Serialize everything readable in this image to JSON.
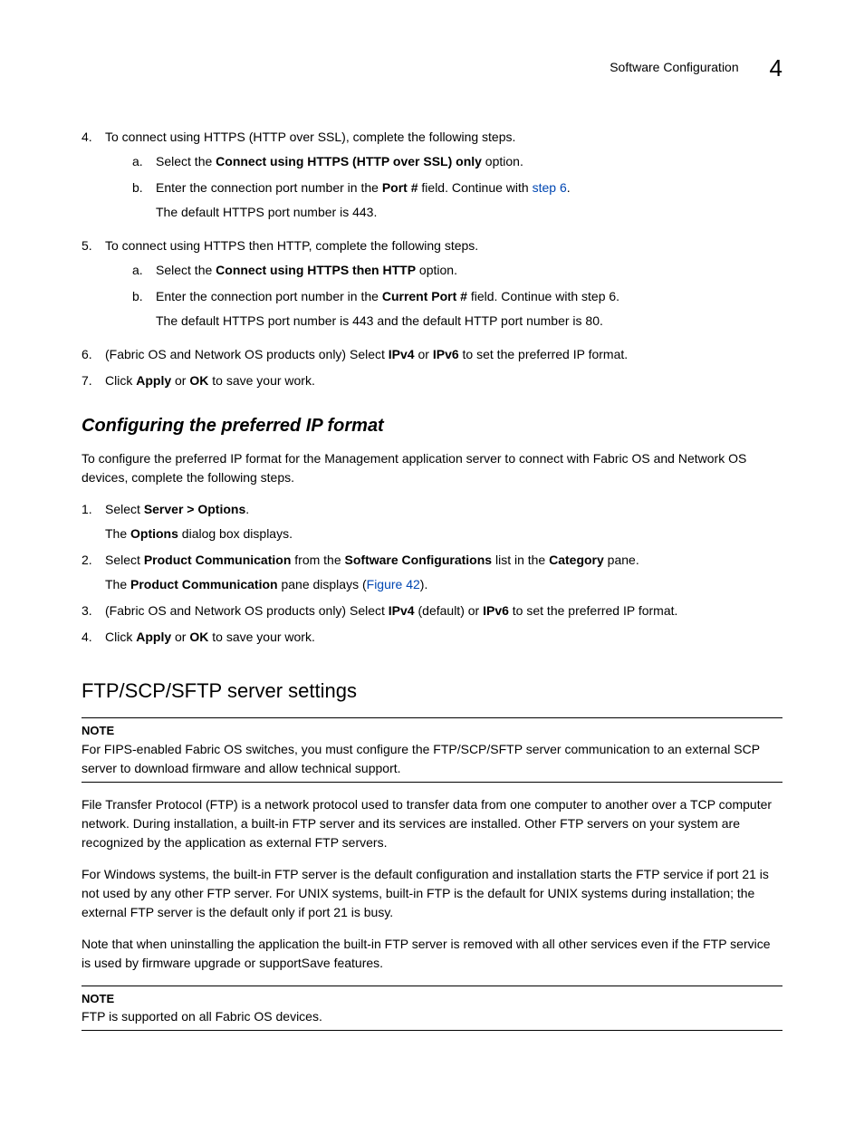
{
  "header": {
    "title": "Software Configuration",
    "chapter": "4"
  },
  "list1": {
    "items": [
      {
        "marker": "4.",
        "runs": [
          {
            "t": "To connect using HTTPS (HTTP over SSL), complete the following steps."
          }
        ],
        "sub": [
          {
            "marker": "a.",
            "runs": [
              {
                "t": "Select the "
              },
              {
                "t": "Connect using HTTPS (HTTP over SSL) only",
                "b": true
              },
              {
                "t": " option."
              }
            ]
          },
          {
            "marker": "b.",
            "runs": [
              {
                "t": "Enter the connection port number in the "
              },
              {
                "t": "Port #",
                "b": true
              },
              {
                "t": " field. Continue with "
              },
              {
                "t": "step 6",
                "link": true
              },
              {
                "t": "."
              }
            ],
            "cont": [
              {
                "t": "The default HTTPS port number is 443."
              }
            ]
          }
        ]
      },
      {
        "marker": "5.",
        "runs": [
          {
            "t": "To connect using HTTPS then HTTP, complete the following steps."
          }
        ],
        "sub": [
          {
            "marker": "a.",
            "runs": [
              {
                "t": "Select the "
              },
              {
                "t": "Connect using HTTPS then HTTP",
                "b": true
              },
              {
                "t": " option."
              }
            ]
          },
          {
            "marker": "b.",
            "runs": [
              {
                "t": "Enter the connection port number in the "
              },
              {
                "t": "Current Port #",
                "b": true
              },
              {
                "t": " field. Continue with step 6."
              }
            ],
            "cont": [
              {
                "t": "The default HTTPS port number is 443 and the default HTTP port number is 80."
              }
            ]
          }
        ]
      },
      {
        "marker": "6.",
        "runs": [
          {
            "t": "(Fabric OS and Network OS products only) Select "
          },
          {
            "t": "IPv4",
            "b": true
          },
          {
            "t": " or "
          },
          {
            "t": "IPv6",
            "b": true
          },
          {
            "t": " to set the preferred IP format."
          }
        ]
      },
      {
        "marker": "7.",
        "runs": [
          {
            "t": "Click "
          },
          {
            "t": "Apply",
            "b": true
          },
          {
            "t": " or "
          },
          {
            "t": "OK",
            "b": true
          },
          {
            "t": " to save your work."
          }
        ]
      }
    ]
  },
  "sec2": {
    "title": "Configuring the preferred IP format",
    "intro": "To configure the preferred IP format for the Management application server to connect with Fabric OS and Network OS devices, complete the following steps.",
    "items": [
      {
        "marker": "1.",
        "runs": [
          {
            "t": "Select "
          },
          {
            "t": "Server > Options",
            "b": true
          },
          {
            "t": "."
          }
        ],
        "cont": [
          {
            "t": "The "
          },
          {
            "t": "Options",
            "b": true
          },
          {
            "t": " dialog box displays."
          }
        ]
      },
      {
        "marker": "2.",
        "runs": [
          {
            "t": "Select "
          },
          {
            "t": "Product Communication",
            "b": true
          },
          {
            "t": " from the "
          },
          {
            "t": "Software Configurations",
            "b": true
          },
          {
            "t": " list in the "
          },
          {
            "t": "Category",
            "b": true
          },
          {
            "t": " pane."
          }
        ],
        "cont": [
          {
            "t": "The "
          },
          {
            "t": "Product Communication",
            "b": true
          },
          {
            "t": " pane displays ("
          },
          {
            "t": "Figure 42",
            "link": true
          },
          {
            "t": ")."
          }
        ]
      },
      {
        "marker": "3.",
        "runs": [
          {
            "t": "(Fabric OS and Network OS products only) Select "
          },
          {
            "t": "IPv4",
            "b": true
          },
          {
            "t": " (default) or "
          },
          {
            "t": "IPv6",
            "b": true
          },
          {
            "t": " to set the preferred IP format."
          }
        ]
      },
      {
        "marker": "4.",
        "runs": [
          {
            "t": "Click "
          },
          {
            "t": "Apply",
            "b": true
          },
          {
            "t": " or "
          },
          {
            "t": "OK",
            "b": true
          },
          {
            "t": " to save your work."
          }
        ]
      }
    ]
  },
  "sec3": {
    "title": "FTP/SCP/SFTP server settings",
    "note1": {
      "label": "NOTE",
      "text": "For FIPS-enabled Fabric OS switches, you must configure the FTP/SCP/SFTP server communication to an external SCP server to download firmware and allow technical support."
    },
    "para1": "File Transfer Protocol (FTP) is a network protocol used to transfer data from one computer to another over a TCP computer network. During installation, a built-in FTP server and its services are installed. Other FTP servers on your system are recognized by the application as external FTP servers.",
    "para2": "For Windows systems, the built-in FTP server is the default configuration and installation starts the FTP service if port 21 is not used by any other FTP server. For UNIX systems, built-in FTP is the default for UNIX systems during installation; the external FTP server is the default only if port 21 is busy.",
    "para3": "Note that when uninstalling the application the built-in FTP server is removed with all other services even if the FTP service is used by firmware upgrade or supportSave features.",
    "note2": {
      "label": "NOTE",
      "text": "FTP is supported on all Fabric OS devices."
    }
  }
}
